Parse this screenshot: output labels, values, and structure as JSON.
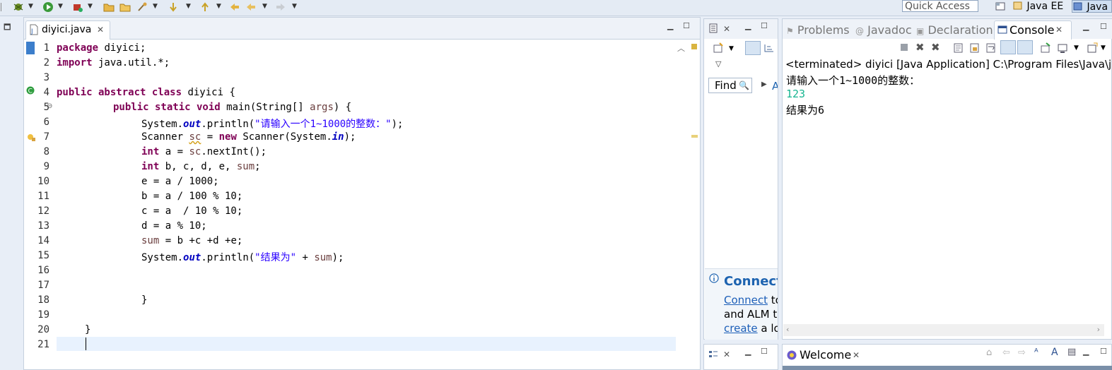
{
  "toolbar": {
    "quick_access_placeholder": "Quick Access",
    "perspectives": [
      "Java EE",
      "Java"
    ]
  },
  "editor": {
    "tab_label": "diyici.java",
    "lines": [
      "1",
      "2",
      "3",
      "4",
      "5",
      "6",
      "7",
      "8",
      "9",
      "10",
      "11",
      "12",
      "13",
      "14",
      "15",
      "16",
      "17",
      "18",
      "19",
      "20",
      "21"
    ],
    "code": {
      "l1_kw": "package",
      "l1_rest": " diyici;",
      "l2_kw": "import",
      "l2_rest": " java.util.*;",
      "l4_kw": "public abstract class",
      "l4_rest": " diyici {",
      "l5_kw": "public static void",
      "l5_rest": " main(String[] ",
      "l5_var": "args",
      "l5_end": ") {",
      "l6_a": "System.",
      "l6_fld": "out",
      "l6_b": ".println(",
      "l6_str": "\"请输入一个1~1000的整数：\"",
      "l6_end": ");",
      "l7_a": "Scanner ",
      "l7_var": "sc",
      "l7_b": " = ",
      "l7_kw": "new",
      "l7_c": " Scanner(System.",
      "l7_fld": "in",
      "l7_end": ");",
      "l8_kw": "int",
      "l8_rest": " a = ",
      "l8_var": "sc",
      "l8_end": ".nextInt();",
      "l9_kw": "int",
      "l9_rest": " b, c, d, e, ",
      "l9_var": "sum",
      "l9_end": ";",
      "l10": "e = a / 1000;",
      "l11": "b = a / 100 % 10;",
      "l12": "c = a  / 10 % 10;",
      "l13": "d = a % 10;",
      "l14_var": "sum",
      "l14_rest": " = b +c +d +e;",
      "l15_a": "System.",
      "l15_fld": "out",
      "l15_b": ".println(",
      "l15_str": "\"结果为\"",
      "l15_c": " + ",
      "l15_var": "sum",
      "l15_end": ");",
      "l18": "}",
      "l20": "}"
    }
  },
  "outline": {
    "find_label": "Find",
    "connect_title": "Connect",
    "connect_link": "Connect",
    "connect_text1": " to",
    "connect_text2": "and ALM t",
    "create_link": "create",
    "create_text": " a lo"
  },
  "console": {
    "tabs": [
      "Problems",
      "Javadoc",
      "Declaration",
      "Console"
    ],
    "header": "<terminated> diyici [Java Application] C:\\Program Files\\Java\\jre",
    "output": [
      "请输入一个1~1000的整数：",
      "123",
      "结果为6"
    ],
    "input_color": "#17b591"
  },
  "welcome": {
    "tab_label": "Welcome"
  }
}
